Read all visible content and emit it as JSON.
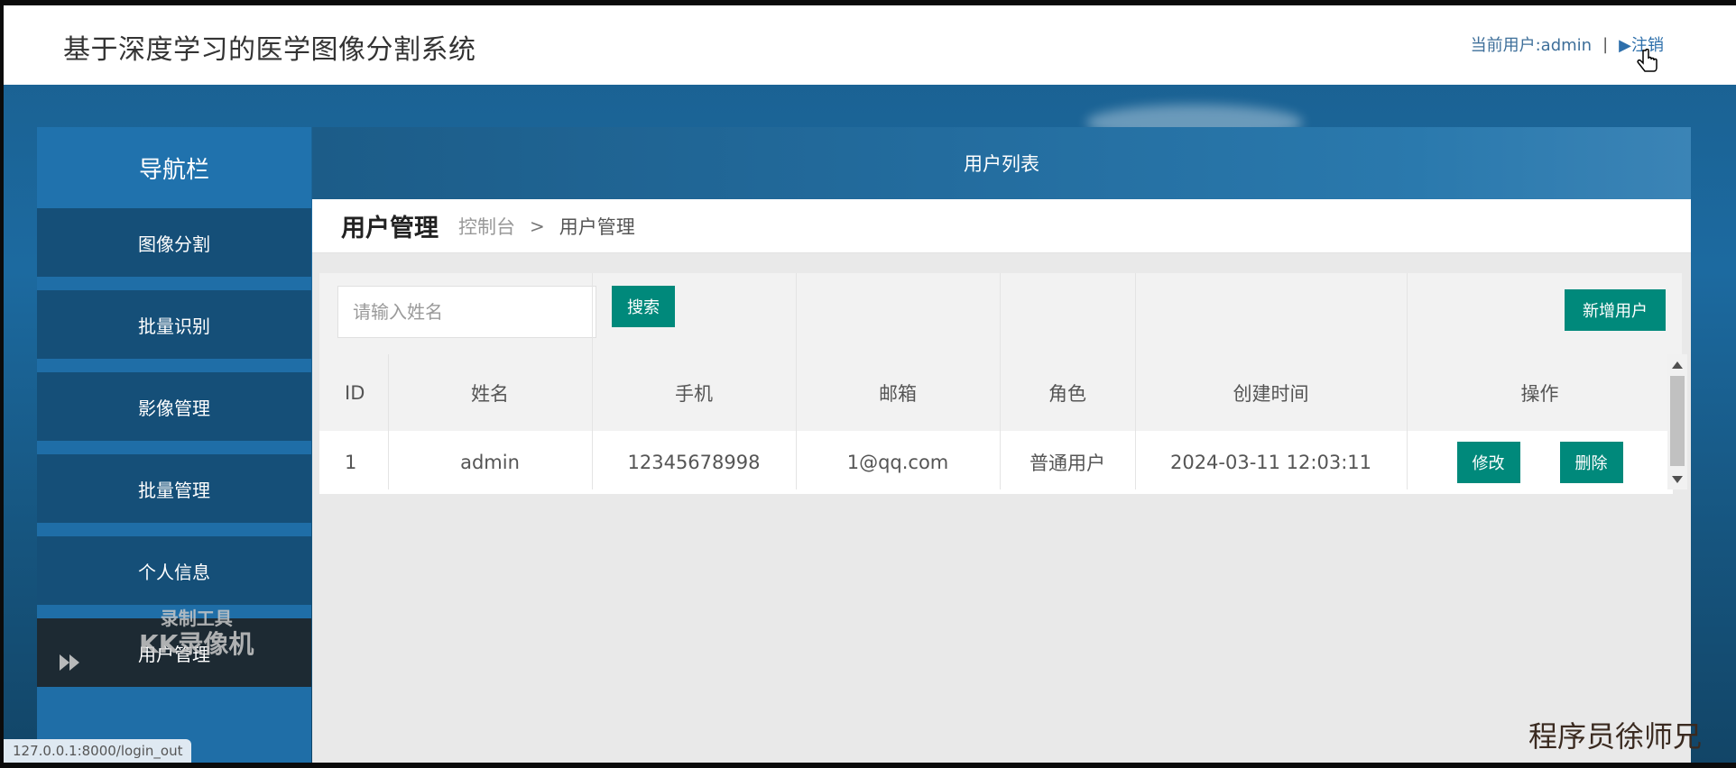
{
  "header": {
    "app_title": "基于深度学习的医学图像分割系统",
    "current_user_label": "当前用户:admin",
    "separator": "|",
    "logout_label": "▶注销"
  },
  "sidebar": {
    "title": "导航栏",
    "items": [
      {
        "label": "图像分割"
      },
      {
        "label": "批量识别"
      },
      {
        "label": "影像管理"
      },
      {
        "label": "批量管理"
      },
      {
        "label": "个人信息"
      },
      {
        "label": "用户管理"
      }
    ]
  },
  "main": {
    "panel_title": "用户列表",
    "page_title": "用户管理",
    "breadcrumb": [
      "控制台",
      "用户管理"
    ],
    "breadcrumb_sep": ">"
  },
  "toolbar": {
    "search_placeholder": "请输入姓名",
    "search_label": "搜索",
    "add_user_label": "新增用户"
  },
  "table": {
    "columns": [
      "ID",
      "姓名",
      "手机",
      "邮箱",
      "角色",
      "创建时间",
      "操作"
    ],
    "rows": [
      {
        "id": "1",
        "name": "admin",
        "phone": "12345678998",
        "email": "1@qq.com",
        "role": "普通用户",
        "created": "2024-03-11 12:03:11",
        "edit_label": "修改",
        "delete_label": "删除"
      }
    ]
  },
  "statusbar": {
    "url": "127.0.0.1:8000/login_out"
  },
  "overlay": {
    "recorder_line1": "录制工具",
    "recorder_line2": "KK录像机",
    "author": "程序员徐师兄"
  },
  "colors": {
    "brand_green": "#00897b",
    "sidebar_blue": "#1f6ea7",
    "nav_item": "#154f78",
    "active_item": "#1d2a33"
  }
}
